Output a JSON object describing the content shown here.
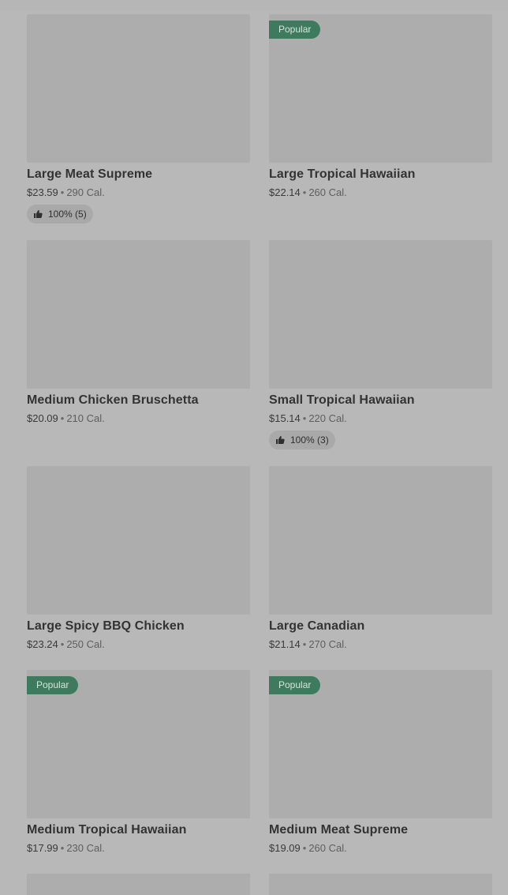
{
  "colors": {
    "overlay_bg": "#b8b8b8",
    "thumb_bg": "#adadad",
    "badge_bg": "#3d7a5e",
    "badge_text": "#d6e6dc"
  },
  "rows": [
    {
      "items": [
        {
          "name": "Large Meat Supreme",
          "price": "$23.59",
          "calories": "290 Cal.",
          "badge": "",
          "rating": "100% (5)"
        },
        {
          "name": "Large Tropical Hawaiian",
          "price": "$22.14",
          "calories": "260 Cal.",
          "badge": "Popular",
          "rating": ""
        }
      ]
    },
    {
      "items": [
        {
          "name": "Medium Chicken Bruschetta",
          "price": "$20.09",
          "calories": "210 Cal.",
          "badge": "",
          "rating": ""
        },
        {
          "name": "Small Tropical Hawaiian",
          "price": "$15.14",
          "calories": "220 Cal.",
          "badge": "",
          "rating": "100% (3)"
        }
      ]
    },
    {
      "items": [
        {
          "name": "Large Spicy BBQ Chicken",
          "price": "$23.24",
          "calories": "250 Cal.",
          "badge": "",
          "rating": ""
        },
        {
          "name": "Large Canadian",
          "price": "$21.14",
          "calories": "270 Cal.",
          "badge": "",
          "rating": ""
        }
      ]
    },
    {
      "items": [
        {
          "name": "Medium Tropical Hawaiian",
          "price": "$17.99",
          "calories": "230 Cal.",
          "badge": "Popular",
          "rating": ""
        },
        {
          "name": "Medium Meat Supreme",
          "price": "$19.09",
          "calories": "260 Cal.",
          "badge": "Popular",
          "rating": ""
        }
      ]
    }
  ],
  "icons": {
    "rating_icon": "thumbs-up-icon"
  }
}
